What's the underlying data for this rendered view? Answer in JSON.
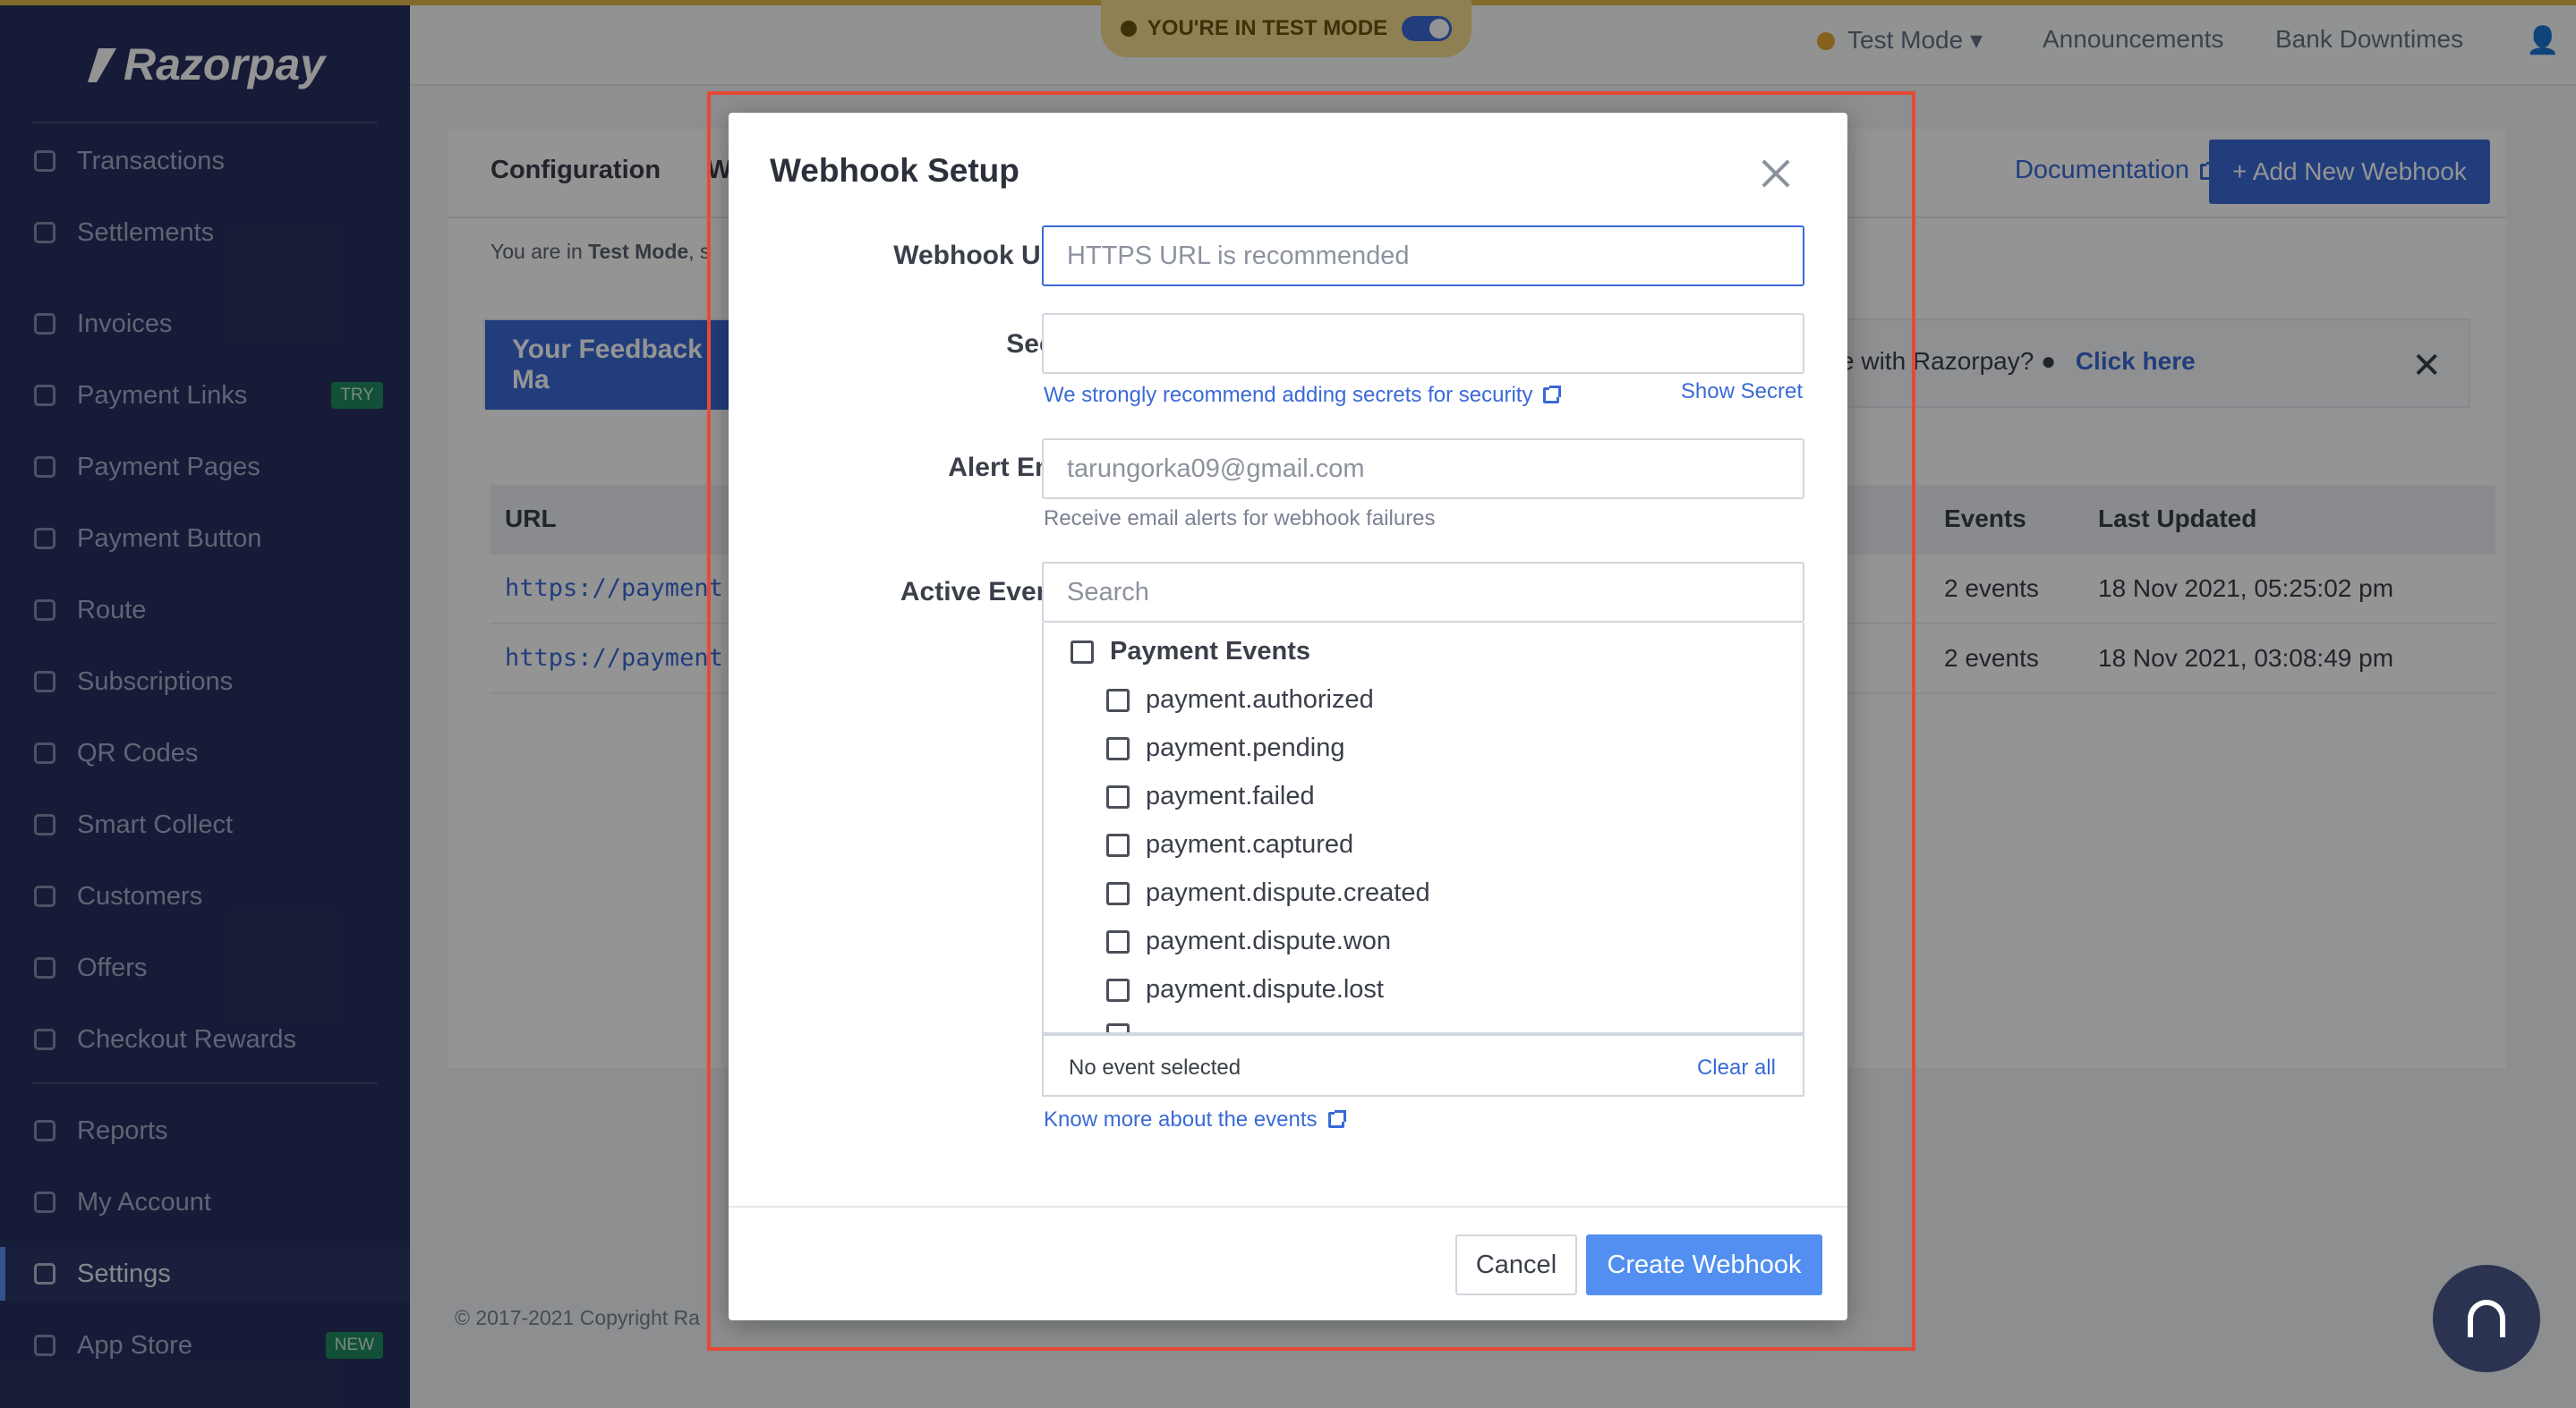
{
  "sidebar": {
    "brand": "Razorpay",
    "items": [
      {
        "label": "Transactions",
        "icon": "transactions-icon"
      },
      {
        "label": "Settlements",
        "icon": "settlements-icon"
      },
      {
        "label": "Invoices",
        "icon": "invoices-icon"
      },
      {
        "label": "Payment Links",
        "icon": "link-icon",
        "badge": "TRY"
      },
      {
        "label": "Payment Pages",
        "icon": "page-icon"
      },
      {
        "label": "Payment Button",
        "icon": "button-icon"
      },
      {
        "label": "Route",
        "icon": "route-icon"
      },
      {
        "label": "Subscriptions",
        "icon": "subscriptions-icon"
      },
      {
        "label": "QR Codes",
        "icon": "qr-icon"
      },
      {
        "label": "Smart Collect",
        "icon": "bank-icon"
      },
      {
        "label": "Customers",
        "icon": "customers-icon"
      },
      {
        "label": "Offers",
        "icon": "tag-icon"
      },
      {
        "label": "Checkout Rewards",
        "icon": "gift-icon"
      },
      {
        "label": "Reports",
        "icon": "reports-icon"
      },
      {
        "label": "My Account",
        "icon": "account-icon"
      },
      {
        "label": "Settings",
        "icon": "gear-icon",
        "active": true
      },
      {
        "label": "App Store",
        "icon": "grid-icon",
        "badge": "NEW"
      }
    ]
  },
  "topbar": {
    "test_mode_banner": "YOU'RE IN TEST MODE",
    "mode": "Test Mode",
    "announcements": "Announcements",
    "bank_downtimes": "Bank Downtimes"
  },
  "page": {
    "tab_configuration": "Configuration",
    "tab_partial": "W",
    "documentation": "Documentation",
    "add_webhook": "+ Add New Webhook",
    "mode_note_prefix": "You are in ",
    "mode_note_bold": "Test Mode",
    "mode_note_suffix": ", s",
    "feedback_title": "Your Feedback Ma",
    "feedback_question": "ce with Razorpay?",
    "feedback_link": "Click here",
    "table": {
      "headers": {
        "url": "URL",
        "events": "Events",
        "last_updated": "Last Updated"
      },
      "rows": [
        {
          "url": "https://payment",
          "events": "2 events",
          "last_updated": "18 Nov 2021, 05:25:02 pm"
        },
        {
          "url": "https://payment",
          "events": "2 events",
          "last_updated": "18 Nov 2021, 03:08:49 pm"
        }
      ]
    },
    "footer_copy": "© 2017-2021 Copyright Ra"
  },
  "modal": {
    "title": "Webhook Setup",
    "webhook_url_label": "Webhook URL",
    "webhook_url_placeholder": "HTTPS URL is recommended",
    "webhook_url_value": "",
    "secret_label": "Secret",
    "secret_value": "",
    "secret_hint": "We strongly recommend adding secrets for security",
    "show_secret": "Show Secret",
    "alert_email_label": "Alert Email",
    "alert_email_value": "tarungorka09@gmail.com",
    "alert_email_hint": "Receive email alerts for webhook failures",
    "active_events_label": "Active Events",
    "search_placeholder": "Search",
    "event_group": "Payment Events",
    "events": [
      "payment.authorized",
      "payment.pending",
      "payment.failed",
      "payment.captured",
      "payment.dispute.created",
      "payment.dispute.won",
      "payment.dispute.lost"
    ],
    "selection_status": "No event selected",
    "clear_all": "Clear all",
    "know_more": "Know more about the events",
    "cancel": "Cancel",
    "create": "Create Webhook"
  },
  "colors": {
    "accent": "#528ff0",
    "sidebar_bg": "#27315f",
    "required": "#e64a35",
    "highlight_box": "#e64a35"
  }
}
